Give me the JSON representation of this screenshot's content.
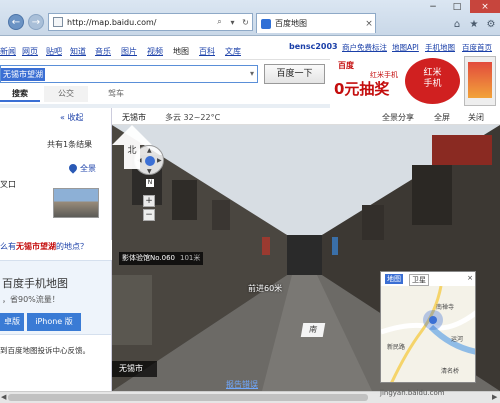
{
  "browser": {
    "url": "http://map.baidu.com/",
    "tab_title": "百度地图",
    "search_glyph": "⌕",
    "dropdown_glyph": "▾",
    "refresh_glyph": "↻",
    "close_glyph": "×",
    "min_glyph": "−",
    "max_glyph": "□",
    "back_glyph": "←",
    "fwd_glyph": "→",
    "home_glyph": "⌂",
    "star_glyph": "★",
    "gear_glyph": "⚙"
  },
  "top_nav": {
    "links": [
      "新闻",
      "网页",
      "贴吧",
      "知道",
      "音乐",
      "图片",
      "视频",
      "地图",
      "百科",
      "文库"
    ],
    "user": "bensc2003",
    "right_links": [
      "商户免费标注",
      "地图API",
      "手机地图",
      "百度首页"
    ]
  },
  "search": {
    "query": "无锡市望湖",
    "button": "百度一下",
    "modes": [
      "搜索",
      "公交",
      "驾车"
    ]
  },
  "ad": {
    "logo": "百度",
    "text": "红米手机",
    "headline": "0元抽奖",
    "badge": "红米\n手机"
  },
  "left_panel": {
    "collapse": "« 收起",
    "count": "共有1条结果",
    "panorama_link": "全景",
    "address": "叉口",
    "question_prefix": "么有",
    "question_highlight": "无锡市望湖",
    "question_suffix": "的地点？",
    "promo_title": "百度手机地图",
    "promo_sub": "，省90%流量！",
    "btn_android": "卓版",
    "btn_iphone": "iPhone 版",
    "feedback": "到百度地图投诉中心反馈。"
  },
  "pano_toolbar": {
    "city": "无锡市",
    "weather": "多云  32~22°C",
    "share": "全景分享",
    "fullscreen": "全屏",
    "close": "关闭"
  },
  "pano": {
    "poi": "影体验馆No.060",
    "poi_dist": "101米",
    "distance": "前进60米",
    "south": "南",
    "north": "北",
    "city": "无锡市",
    "report": "报告错误",
    "n_badge": "N",
    "zoom_in": "+",
    "zoom_out": "−"
  },
  "minimap": {
    "tab_map": "地图",
    "tab_sat": "卫星",
    "labels": [
      "南禅寺",
      "新民路",
      "运河",
      "清名桥"
    ]
  },
  "watermark": "jingyan.baidu.com"
}
